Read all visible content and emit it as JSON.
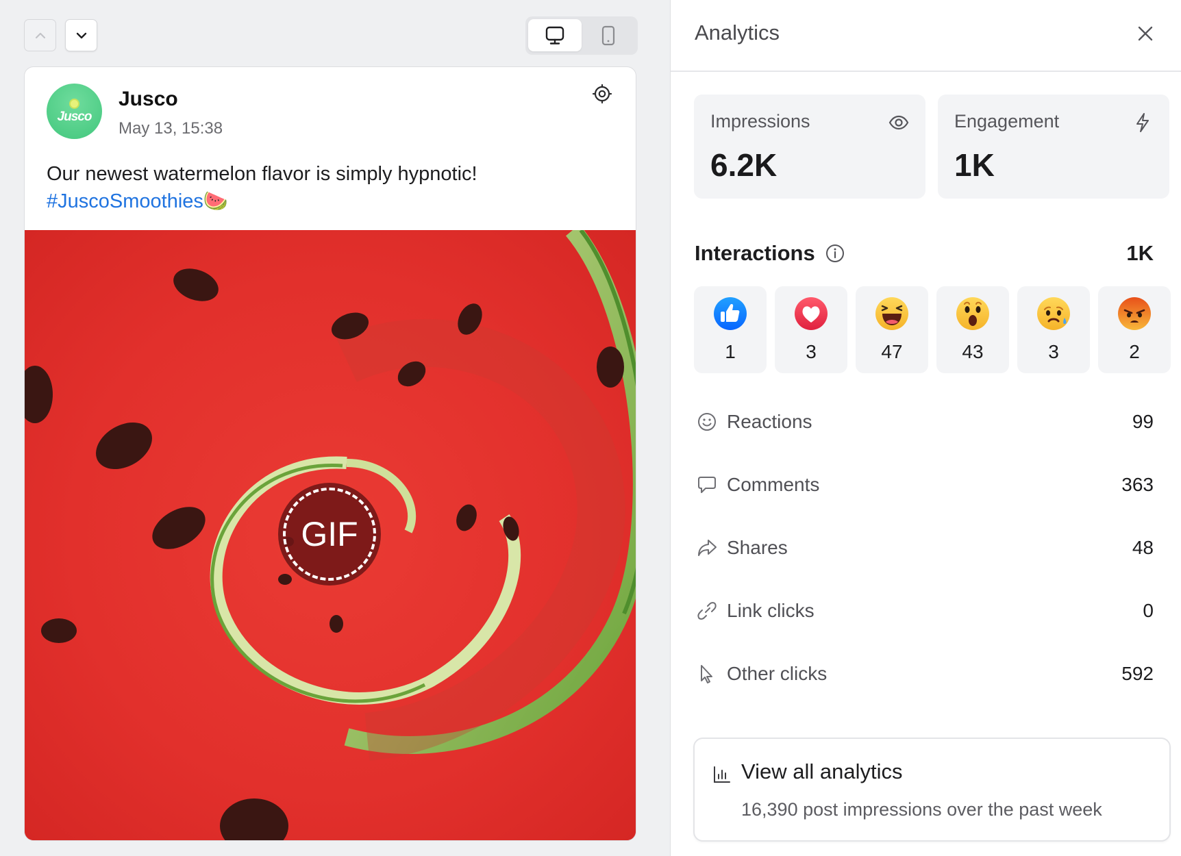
{
  "toolbar": {
    "prev_icon": "chevron-up-icon",
    "next_icon": "chevron-down-icon",
    "view_modes": [
      {
        "name": "desktop",
        "icon": "monitor-icon",
        "selected": true
      },
      {
        "name": "mobile",
        "icon": "phone-icon",
        "selected": false
      }
    ]
  },
  "post": {
    "author": "Jusco",
    "avatar_text": "Jusco",
    "timestamp": "May 13, 15:38",
    "text": "Our newest watermelon flavor is simply hypnotic!",
    "hashtag": "#JuscoSmoothies",
    "hashtag_emoji": "🍉",
    "media_badge": "GIF",
    "target_icon": "crosshair-icon",
    "colors": {
      "hashtag": "#1f73e0",
      "avatar": "#4fcf88"
    }
  },
  "panel": {
    "title": "Analytics",
    "close_icon": "close-icon",
    "stats": [
      {
        "label": "Impressions",
        "value": "6.2K",
        "icon": "eye-icon"
      },
      {
        "label": "Engagement",
        "value": "1K",
        "icon": "lightning-icon"
      }
    ],
    "interactions": {
      "title": "Interactions",
      "info_icon": "info-icon",
      "total": "1K",
      "reactions": [
        {
          "type": "like",
          "count": "1"
        },
        {
          "type": "love",
          "count": "3"
        },
        {
          "type": "haha",
          "count": "47"
        },
        {
          "type": "wow",
          "count": "43"
        },
        {
          "type": "sad",
          "count": "3"
        },
        {
          "type": "angry",
          "count": "2"
        }
      ]
    },
    "metrics": [
      {
        "label": "Reactions",
        "value": "99",
        "icon": "smiley-icon"
      },
      {
        "label": "Comments",
        "value": "363",
        "icon": "comment-icon"
      },
      {
        "label": "Shares",
        "value": "48",
        "icon": "share-icon"
      },
      {
        "label": "Link clicks",
        "value": "0",
        "icon": "link-icon"
      },
      {
        "label": "Other clicks",
        "value": "592",
        "icon": "cursor-icon"
      }
    ],
    "view_all": {
      "title": "View all analytics",
      "subtitle": "16,390 post impressions over the past week",
      "icon": "bar-chart-icon"
    }
  }
}
